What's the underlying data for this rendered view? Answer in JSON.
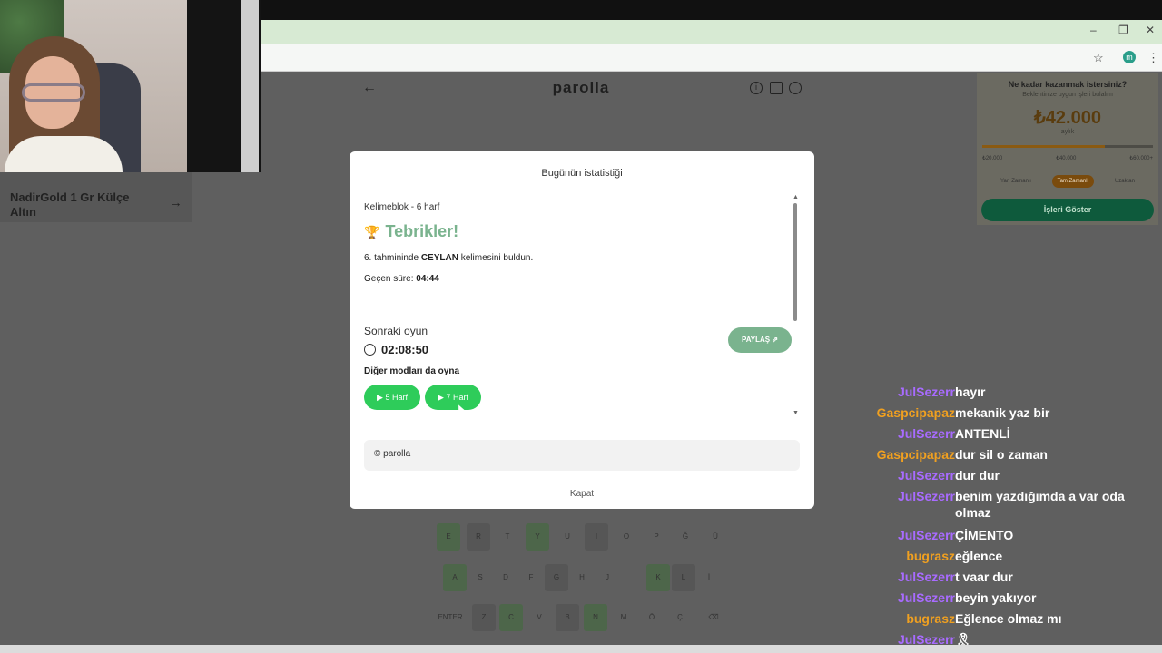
{
  "browser": {
    "window_controls": [
      "–",
      "❐",
      "✕"
    ]
  },
  "left_ad": {
    "title": "NadirGold 1 Gr Külçe Altın"
  },
  "header": {
    "title": "parolla"
  },
  "right_ad": {
    "question": "Ne kadar kazanmak istersiniz?",
    "subtitle": "Beklentinize uygun işleri bulalım",
    "amount": "₺42.000",
    "period": "aylık",
    "slider_level": 0.72,
    "ticks": [
      "₺20.000",
      "₺40.000",
      "₺60.000+"
    ],
    "modes": [
      "Yarı Zamanlı",
      "Tam Zamanlı",
      "Uzaktan"
    ],
    "active_mode": "Tam Zamanlı",
    "cta": "İşleri Göster"
  },
  "keyboard": {
    "row1": [
      "E",
      "R",
      "T",
      "Y",
      "U",
      "I",
      "O",
      "P",
      "Ğ",
      "Ü"
    ],
    "row2": [
      "A",
      "S",
      "D",
      "F",
      "G",
      "H",
      "J",
      "K",
      "L",
      "İ"
    ],
    "row3": [
      "ENTER",
      "Z",
      "C",
      "V",
      "B",
      "N",
      "M",
      "Ö",
      "Ç",
      "⌫"
    ]
  },
  "modal": {
    "title": "Bugünün istatistiği",
    "mode_label": "Kelimeblok - 6 harf",
    "congrats": "Tebrikler!",
    "found_prefix": "6. tahmininde",
    "found_word": "CEYLAN",
    "found_suffix": "kelimesini buldun.",
    "elapsed_label": "Geçen süre:",
    "elapsed_value": "04:44",
    "next_label": "Sonraki oyun",
    "next_timer": "02:08:50",
    "share_label": "PAYLAŞ ⇗",
    "other_modes_label": "Diğer modları da oyna",
    "mode_buttons": [
      "▶ 5 Harf",
      "▶ 7 Harf"
    ],
    "footer": "© parolla",
    "close_label": "Kapat"
  },
  "chat": [
    {
      "user": "JulSezerr",
      "msg": "hayır",
      "color": "#a86bff"
    },
    {
      "user": "Gaspcipapaz",
      "msg": "mekanik yaz bir",
      "color": "#f0a020"
    },
    {
      "user": "JulSezerr",
      "msg": "ANTENLİ",
      "color": "#a86bff"
    },
    {
      "user": "Gaspcipapaz",
      "msg": "dur sil o zaman",
      "color": "#f0a020"
    },
    {
      "user": "JulSezerr",
      "msg": "dur dur",
      "color": "#a86bff"
    },
    {
      "user": "JulSezerr",
      "msg": "benim yazdığımda a var oda olmaz",
      "color": "#a86bff"
    },
    {
      "user": "JulSezerr",
      "msg": "ÇİMENTO",
      "color": "#a86bff"
    },
    {
      "user": "bugrasz",
      "msg": "eğlence",
      "color": "#f0a020"
    },
    {
      "user": "JulSezerr",
      "msg": "t vaar dur",
      "color": "#a86bff"
    },
    {
      "user": "JulSezerr",
      "msg": "beyin yakıyor",
      "color": "#a86bff"
    },
    {
      "user": "bugrasz",
      "msg": "Eğlence olmaz mı",
      "color": "#f0a020"
    },
    {
      "user": "JulSezerr",
      "msg": "🎗",
      "color": "#a86bff"
    }
  ]
}
